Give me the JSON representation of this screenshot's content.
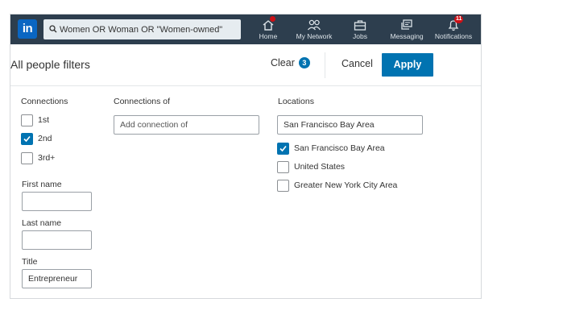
{
  "nav": {
    "logo": "in",
    "search": {
      "value": "Women OR Woman OR \"Women-owned\""
    },
    "items": [
      {
        "label": "Home",
        "icon": "home-icon",
        "badge": ""
      },
      {
        "label": "My Network",
        "icon": "people-icon",
        "badge": ""
      },
      {
        "label": "Jobs",
        "icon": "briefcase-icon",
        "badge": ""
      },
      {
        "label": "Messaging",
        "icon": "messaging-icon",
        "badge": ""
      },
      {
        "label": "Notifications",
        "icon": "bell-icon",
        "badge": "11"
      }
    ]
  },
  "header": {
    "title": "All people filters",
    "clear_label": "Clear",
    "clear_count": "3",
    "cancel_label": "Cancel",
    "apply_label": "Apply"
  },
  "filters": {
    "connections": {
      "label": "Connections",
      "options": [
        {
          "label": "1st",
          "checked": false
        },
        {
          "label": "2nd",
          "checked": true
        },
        {
          "label": "3rd+",
          "checked": false
        }
      ]
    },
    "connections_of": {
      "label": "Connections of",
      "placeholder": "Add connection of"
    },
    "first_name": {
      "label": "First name",
      "value": ""
    },
    "last_name": {
      "label": "Last name",
      "value": ""
    },
    "title": {
      "label": "Title",
      "value": "Entrepreneur"
    },
    "locations": {
      "label": "Locations",
      "input_value": "San Francisco Bay Area",
      "options": [
        {
          "label": "San Francisco Bay Area",
          "checked": true
        },
        {
          "label": "United States",
          "checked": false
        },
        {
          "label": "Greater New York City Area",
          "checked": false
        }
      ]
    }
  },
  "colors": {
    "nav_bg": "#2d3e4e",
    "brand": "#0a66c2",
    "primary": "#0073b1",
    "badge": "#cc1016"
  }
}
